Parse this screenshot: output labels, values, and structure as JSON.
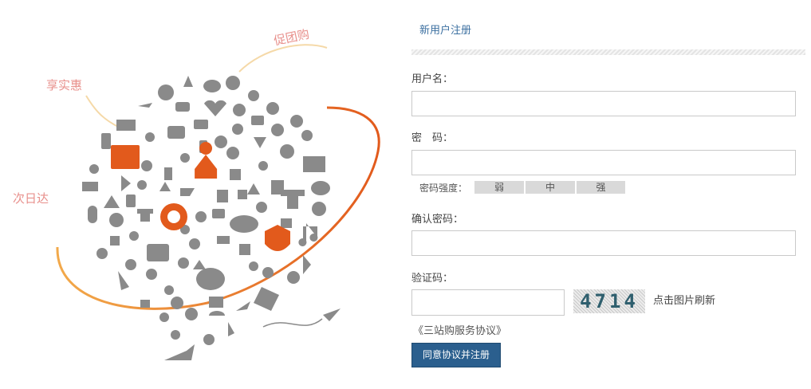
{
  "promo": {
    "tag_group_buy": "促团购",
    "tag_discount": "享实惠",
    "tag_next_day": "次日达"
  },
  "form": {
    "title": "新用户注册",
    "username_label": "用户名：",
    "password_label": "密　码：",
    "strength": {
      "label": "密码强度：",
      "levels": [
        "弱",
        "中",
        "强"
      ]
    },
    "confirm_label": "确认密码：",
    "captcha_label": "验证码：",
    "captcha_code": "4714",
    "captcha_refresh": "点击图片刷新",
    "agreement_link": "《三站购服务协议》",
    "submit_label": "同意协议并注册"
  },
  "colors": {
    "accent_blue": "#2b5f8e",
    "title_blue": "#3b6fa0",
    "swoosh_orange": "#e8862e",
    "icon_gray": "#8a8a8a",
    "highlight_orange": "#e25a1c",
    "tag_pink": "#e8908c"
  }
}
